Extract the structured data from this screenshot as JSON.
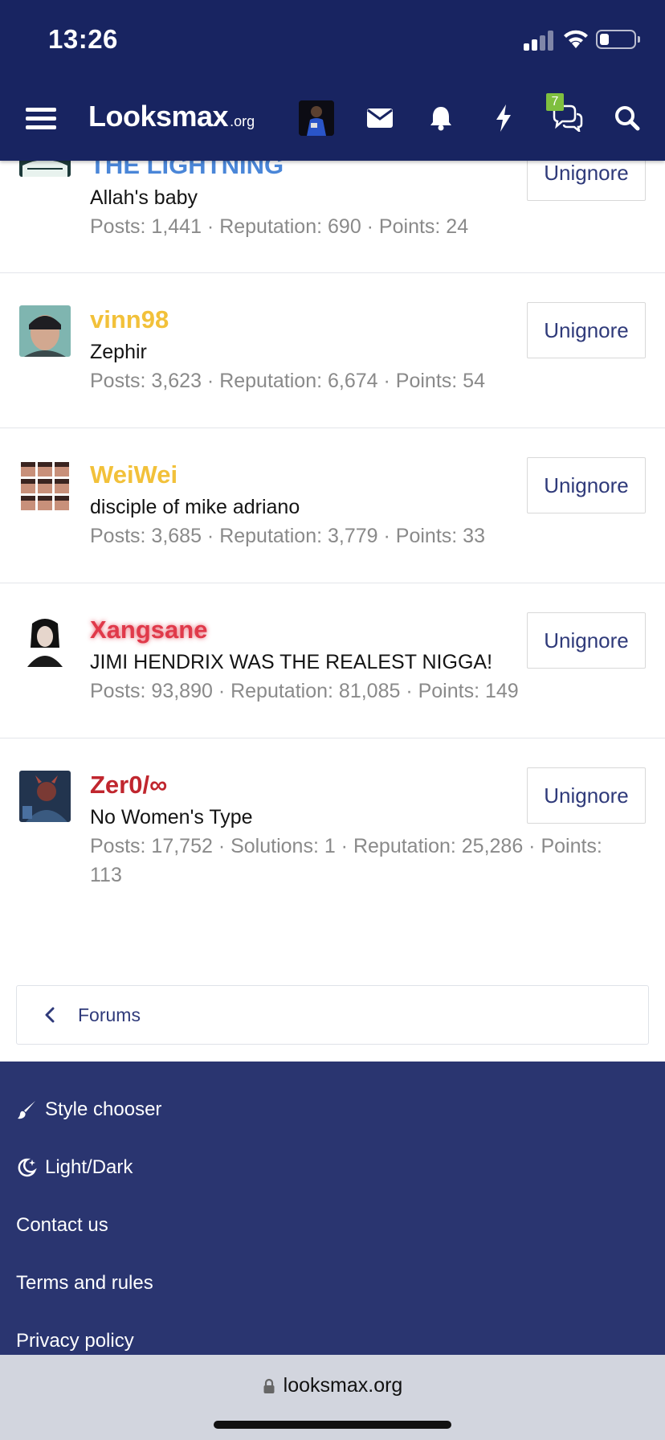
{
  "status": {
    "time": "13:26"
  },
  "header": {
    "logo_main": "Lo​oksmax",
    "logo_main_text": "Looksmax",
    "logo_sub": ".org",
    "notification_badge": "7"
  },
  "members": [
    {
      "name": "THE LIGHTNING",
      "name_color": "#4a86d8",
      "title": "Allah's baby",
      "stats": "Posts: 1,441 · Reputation: 690 · Points: 24",
      "button": "Unignore"
    },
    {
      "name": "vinn98",
      "name_color": "#f2c13a",
      "title": "Zephir",
      "stats": "Posts: 3,623 · Reputation: 6,674 · Points: 54",
      "button": "Unignore"
    },
    {
      "name": "WeiWei",
      "name_color": "#f2c13a",
      "title": "disciple of mike adriano",
      "stats": "Posts: 3,685 · Reputation: 3,779 · Points: 33",
      "button": "Unignore"
    },
    {
      "name": "Xangsane",
      "name_color": "#e0394a",
      "title": "JIMI HENDRIX WAS THE REALEST NIGGA!",
      "stats": "Posts: 93,890 · Reputation: 81,085 · Points: 149",
      "button": "Unignore"
    },
    {
      "name": "Zer0/∞",
      "name_color": "#c0262e",
      "title": "No Women's Type",
      "stats": "Posts: 17,752 · Solutions: 1 · Reputation: 25,286 · Points: 113",
      "button": "Unignore"
    }
  ],
  "breadcrumb": {
    "label": "Forums"
  },
  "footer": {
    "style_chooser": "Style chooser",
    "light_dark": "Light/Dark",
    "contact": "Contact us",
    "terms": "Terms and rules",
    "privacy": "Privacy policy"
  },
  "address_bar": {
    "url": "looksmax.org"
  }
}
